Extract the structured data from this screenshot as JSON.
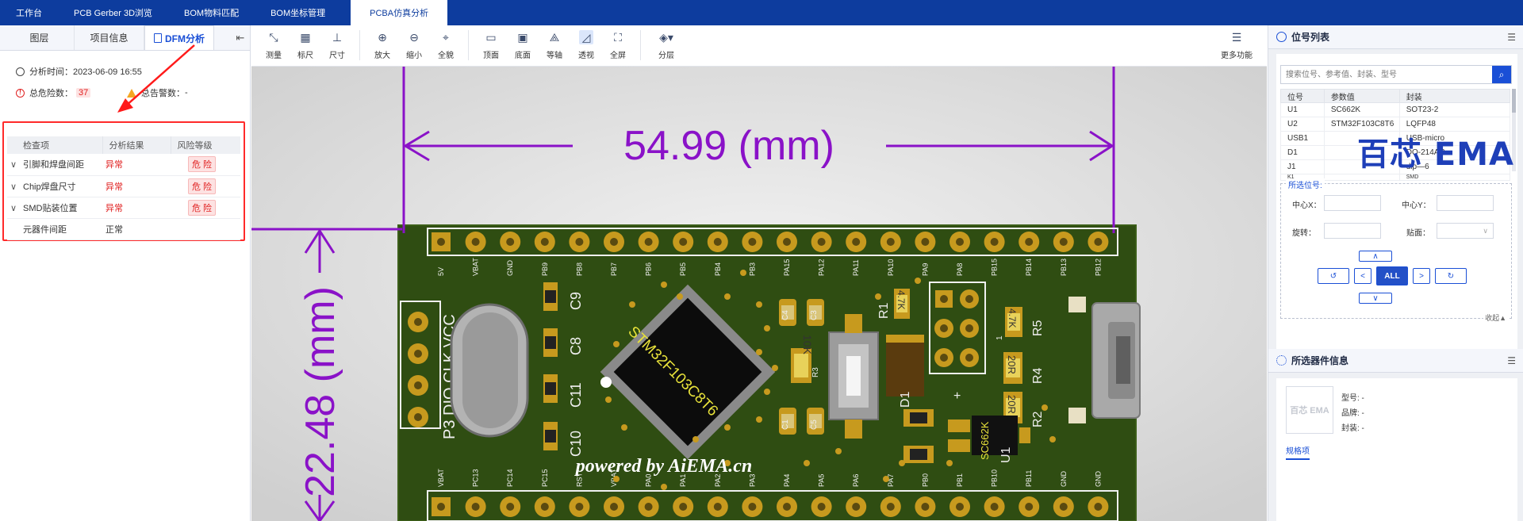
{
  "top_tabs": [
    "工作台",
    "PCB Gerber 3D浏览",
    "BOM物料匹配",
    "BOM坐标管理",
    "PCBA仿真分析"
  ],
  "left": {
    "tabs": [
      "图层",
      "项目信息",
      "DFM分析"
    ],
    "collapse_icon": "⇤",
    "analysis_time": "分析时间：2023-06-09 16:55",
    "danger_label": "总危险数：",
    "danger_count": "37",
    "warn_label": "总告警数：",
    "warn_count": "-",
    "table_headers": [
      "检查项",
      "分析结果",
      "风险等级"
    ],
    "rows": [
      {
        "item": "引脚和焊盘间距",
        "result": "异常",
        "risk": "危 险"
      },
      {
        "item": "Chip焊盘尺寸",
        "result": "异常",
        "risk": "危 险"
      },
      {
        "item": "SMD贴装位置",
        "result": "异常",
        "risk": "危 险"
      },
      {
        "item": "元器件间距",
        "result": "正常",
        "risk": ""
      }
    ]
  },
  "toolbar": {
    "tools": [
      "测量",
      "标尺",
      "尺寸",
      "放大",
      "缩小",
      "全貌",
      "顶面",
      "底面",
      "等轴",
      "透视",
      "全屏",
      "分层"
    ],
    "more": "更多功能"
  },
  "board": {
    "width_dim": "54.99 (mm)",
    "height_dim": "22.48 (mm)",
    "chip_label": "STM32F103C8T6",
    "watermark": "powered by AiEMA.cn",
    "top_pins": [
      "5V",
      "VBAT",
      "GND",
      "PB9",
      "PB8",
      "PB7",
      "PB6",
      "PB5",
      "PB4",
      "PB3",
      "PA15",
      "PA12",
      "PA11",
      "PA10",
      "PA9",
      "PA8",
      "PB15",
      "PB14",
      "PB13",
      "PB12"
    ],
    "bottom_pins": [
      "VBAT",
      "PC13",
      "PC14",
      "PC15",
      "RST",
      "VBAT",
      "PA0",
      "PA1",
      "PA2",
      "PA3",
      "PA4",
      "PA5",
      "PA6",
      "PA7",
      "PB0",
      "PB1",
      "PB10",
      "PB11",
      "GND",
      "GND"
    ],
    "swd_label": "P3   DIO CLK VCC",
    "refdes": {
      "c9": "C9",
      "c8": "C8",
      "c11": "C11",
      "c10": "C10",
      "r1": "R1",
      "r1_val": "4.7K",
      "r3_val": "10K",
      "r5": "R5",
      "r4": "R4",
      "r2": "R2",
      "r4_val": "20R",
      "r2_val": "20R",
      "r5_val": "4.7K",
      "u1": "U1",
      "u1_chip": "SC662K",
      "d1": "D1",
      "c4": "C4",
      "c3": "C3",
      "c1": "C1",
      "c5": "C5",
      "r3": "R3",
      "pin1": "1",
      "plus": "+"
    }
  },
  "right": {
    "pos_title": "位号列表",
    "search_placeholder": "搜索位号、参考值、封装、型号",
    "table_headers": [
      "位号",
      "参数值",
      "封装"
    ],
    "rows": [
      [
        "U1",
        "SC662K",
        "SOT23-2"
      ],
      [
        "U2",
        "STM32F103C8T6",
        "LQFP48"
      ],
      [
        "USB1",
        "",
        "USB-micro"
      ],
      [
        "D1",
        "",
        "DO-214AC"
      ],
      [
        "J1",
        "",
        "dip—6"
      ],
      [
        "K1",
        "",
        "SMD"
      ]
    ],
    "selected_title": "所选位号:",
    "center_x": "中心X：",
    "center_y": "中心Y：",
    "rotate": "旋转：",
    "mount": "贴面：",
    "all_btn": "ALL",
    "collapse": "收起▲",
    "info_title": "所选器件信息",
    "thumb_text": "百芯 EMA",
    "model": "型号: -",
    "brand_lbl": "品牌: -",
    "package": "封装: -",
    "spec_tab": "规格项",
    "brand_logo": "百芯 EMA"
  },
  "colors": {
    "accent": "#0d3c9e",
    "dim_purple": "#8a12c8",
    "pcb_green": "#2f4d12",
    "pad_gold": "#c79a1e",
    "danger": "#e02020"
  }
}
